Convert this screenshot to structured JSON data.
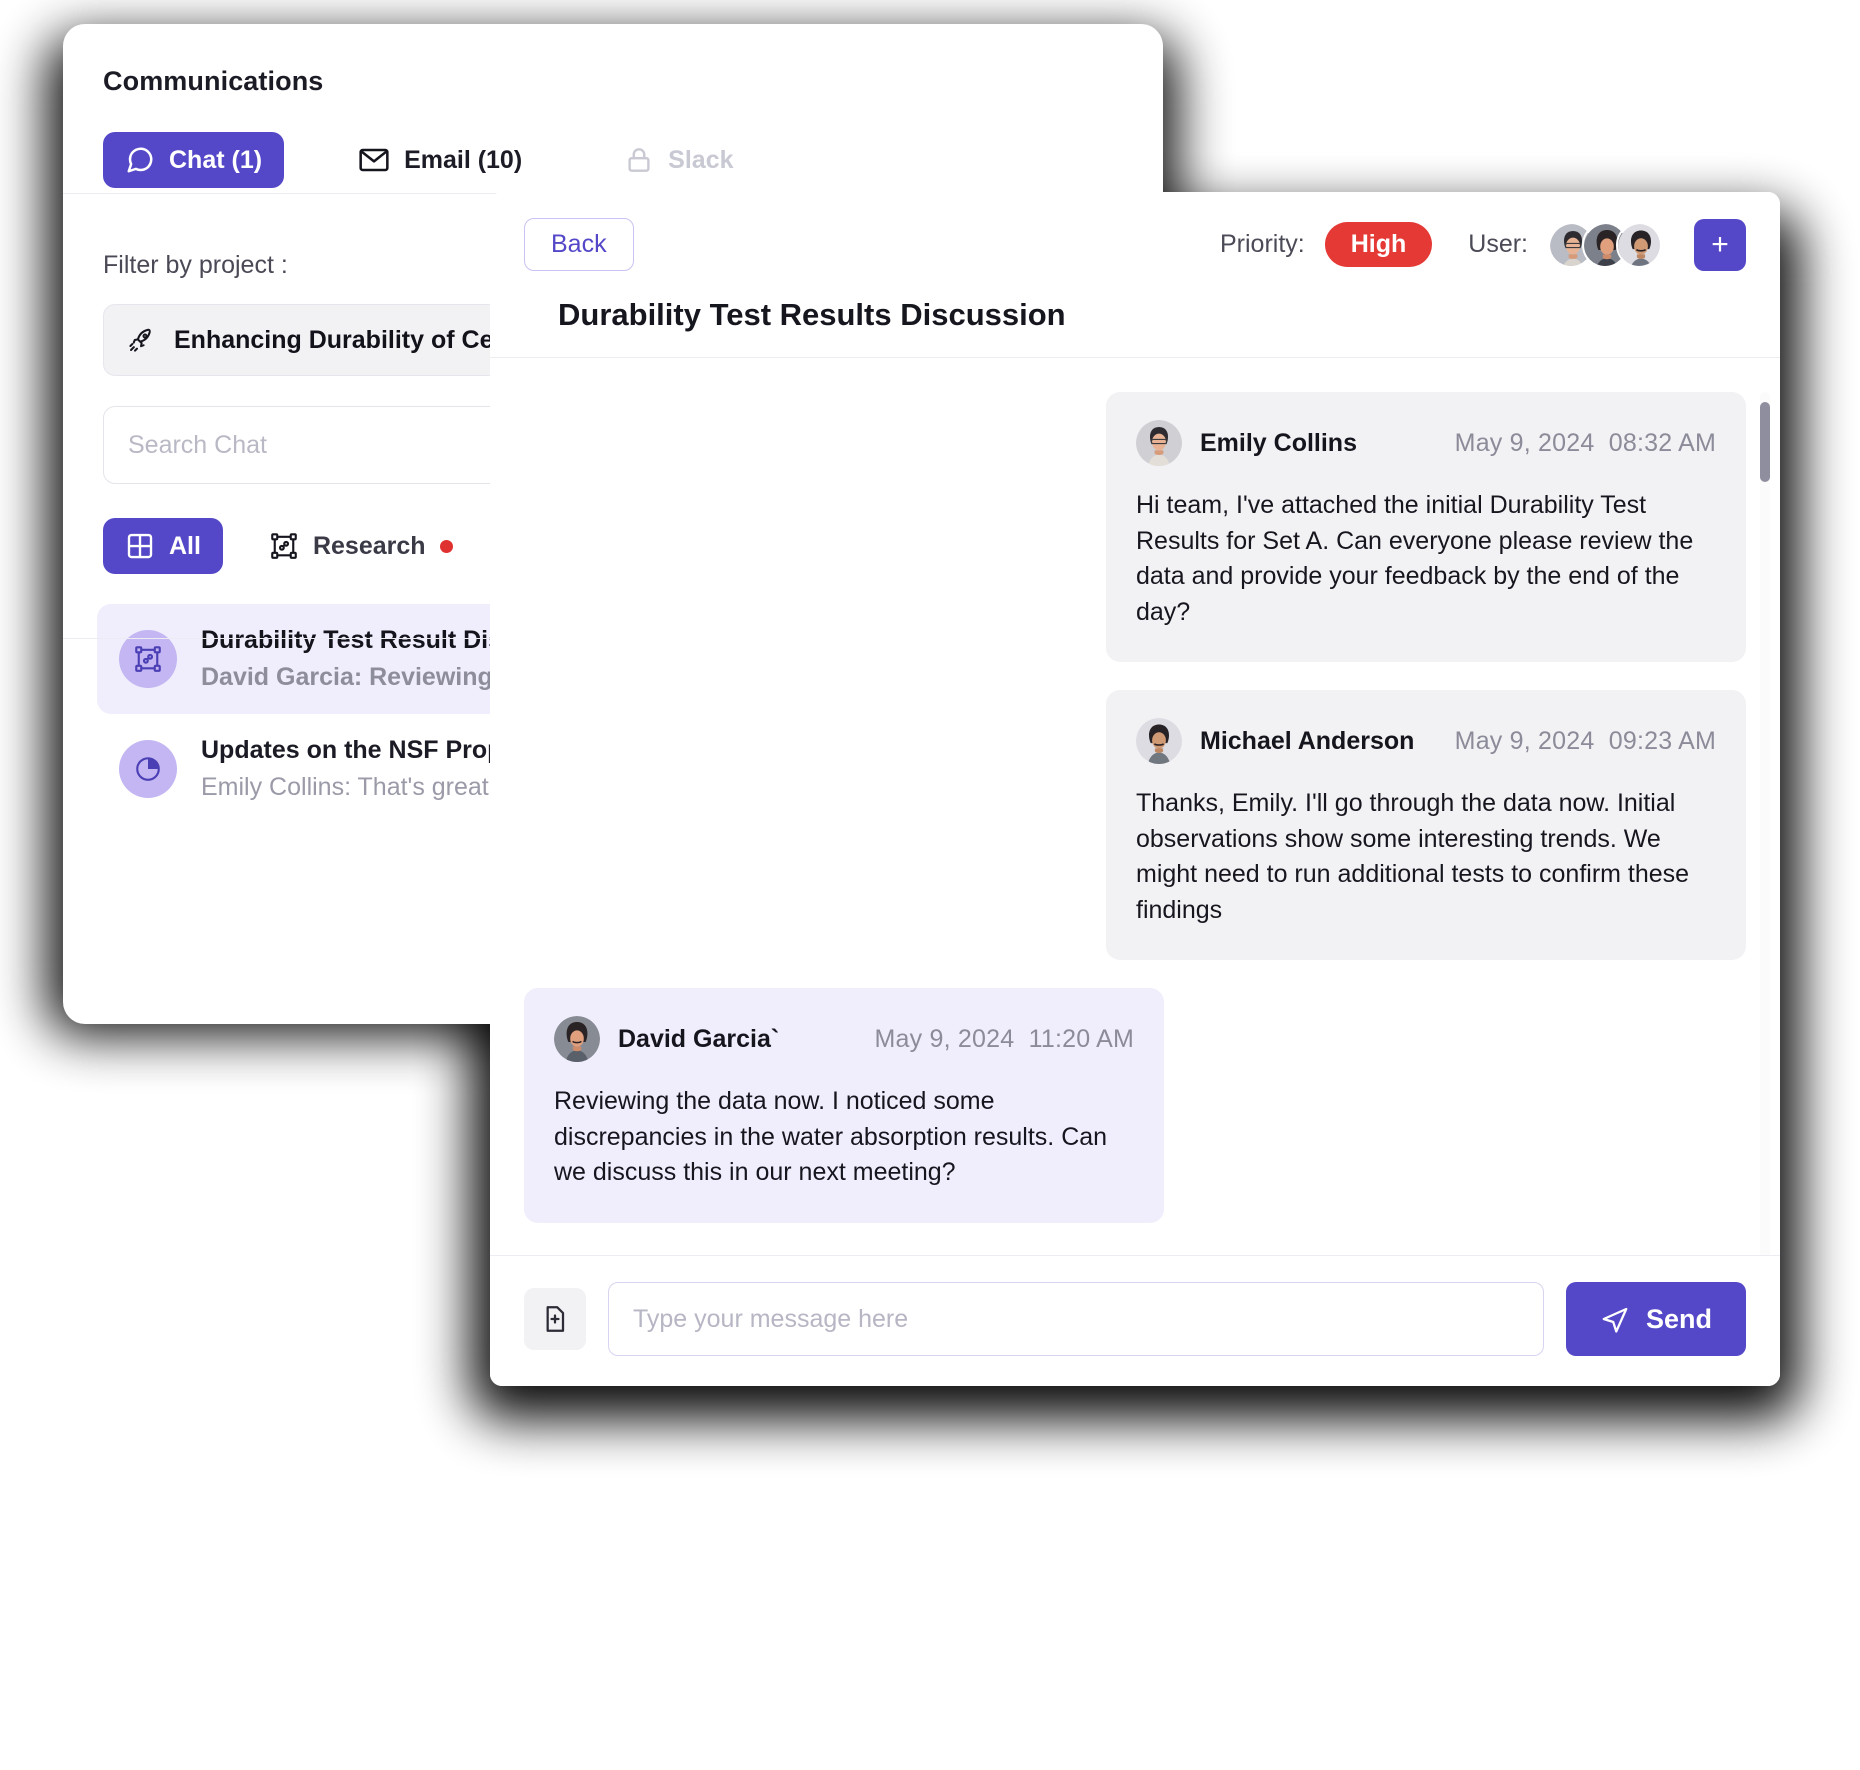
{
  "left_panel": {
    "title": "Communications",
    "tabs": [
      {
        "label": "Chat (1)",
        "icon": "chat-bubble-icon",
        "state": "active"
      },
      {
        "label": "Email (10)",
        "icon": "envelope-icon",
        "state": "default"
      },
      {
        "label": "Slack",
        "icon": "lock-icon",
        "state": "disabled"
      }
    ],
    "filter_label": "Filter by project :",
    "project_selected": "Enhancing Durability of Ce",
    "search_placeholder": "Search Chat",
    "chips": [
      {
        "label": "All",
        "icon": "grid-icon",
        "state": "active",
        "dot": false
      },
      {
        "label": "Research",
        "icon": "node-frame-icon",
        "state": "default",
        "dot": true
      },
      {
        "label": "",
        "icon": "person-circle-icon",
        "state": "default",
        "dot": false
      }
    ],
    "chat_items": [
      {
        "title": "Durability Test Result Discu",
        "snippet": "David Garcia: Reviewing the",
        "icon": "node-frame-icon",
        "selected": true
      },
      {
        "title": "Updates on the NSF Proposa",
        "snippet": "Emily Collins: That's great ne",
        "icon": "pie-chart-icon",
        "selected": false
      }
    ]
  },
  "modal": {
    "back_label": "Back",
    "priority_label": "Priority:",
    "priority_value": "High",
    "user_label": "User:",
    "add_user_label": "+",
    "title": "Durability Test Results Discussion",
    "messages": [
      {
        "author": "Emily Collins",
        "date": "May 9, 2024",
        "time": "08:32 AM",
        "text": "Hi team, I've attached the initial Durability Test Results for Set A. Can everyone please review the data and provide your feedback by the end of the day?",
        "side": "other"
      },
      {
        "author": "Michael Anderson",
        "date": "May 9, 2024",
        "time": "09:23 AM",
        "text": "Thanks, Emily. I'll go through the data now. Initial observations show some interesting trends. We might need to run additional tests to confirm these findings",
        "side": "other"
      },
      {
        "author": "David Garcia`",
        "date": "May 9, 2024",
        "time": "11:20 AM",
        "text": "Reviewing the data now. I noticed some discrepancies in the water absorption results. Can we discuss this in our next meeting?",
        "side": "self"
      }
    ],
    "composer": {
      "attach_icon": "file-plus-icon",
      "placeholder": "Type your message here",
      "send_label": "Send",
      "send_icon": "paper-plane-icon"
    }
  },
  "colors": {
    "accent": "#5448c8",
    "accent_soft": "#f0eefc",
    "priority_high": "#e53935",
    "dot_red": "#e03131",
    "bubble_other": "#f2f2f4"
  }
}
